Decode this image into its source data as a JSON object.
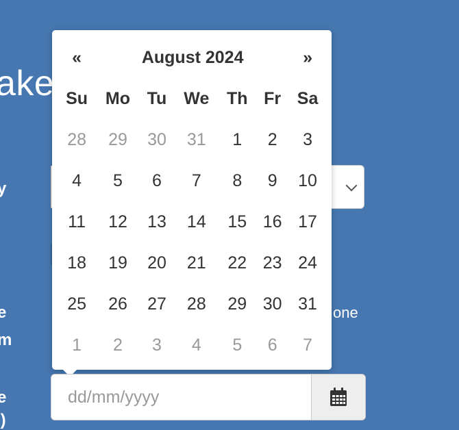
{
  "background": {
    "heading_fragment": "ake",
    "label_fragments": [
      "y",
      "e",
      "m",
      "e",
      "u)"
    ],
    "radio_fragment": "one"
  },
  "datepicker": {
    "prev_label": "«",
    "next_label": "»",
    "title": "August 2024",
    "weekdays": [
      "Su",
      "Mo",
      "Tu",
      "We",
      "Th",
      "Fr",
      "Sa"
    ],
    "weeks": [
      [
        "28",
        "29",
        "30",
        "31",
        "1",
        "2",
        "3"
      ],
      [
        "4",
        "5",
        "6",
        "7",
        "8",
        "9",
        "10"
      ],
      [
        "11",
        "12",
        "13",
        "14",
        "15",
        "16",
        "17"
      ],
      [
        "18",
        "19",
        "20",
        "21",
        "22",
        "23",
        "24"
      ],
      [
        "25",
        "26",
        "27",
        "28",
        "29",
        "30",
        "31"
      ],
      [
        "1",
        "2",
        "3",
        "4",
        "5",
        "6",
        "7"
      ]
    ]
  },
  "date_input": {
    "placeholder": "dd/mm/yyyy",
    "value": "",
    "addon_icon": "calendar-icon"
  },
  "colors": {
    "page_background": "#4677b1",
    "text_muted": "#999999",
    "text_dark": "#333333"
  }
}
